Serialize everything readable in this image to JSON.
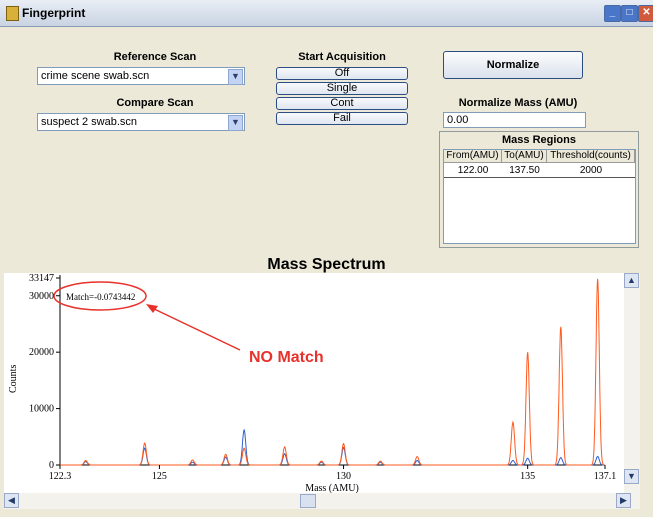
{
  "window": {
    "title": "Fingerprint"
  },
  "reference_scan": {
    "label": "Reference Scan",
    "value": "crime scene swab.scn"
  },
  "compare_scan": {
    "label": "Compare Scan",
    "value": "suspect 2 swab.scn"
  },
  "acquisition": {
    "label": "Start Acquisition",
    "buttons": [
      "Off",
      "Single",
      "Cont",
      "Fail"
    ]
  },
  "normalize": {
    "button_label": "Normalize",
    "mass_label": "Normalize Mass (AMU)",
    "mass_value": "0.00"
  },
  "mass_regions": {
    "title": "Mass Regions",
    "columns": [
      "From(AMU)",
      "To(AMU)",
      "Threshold(counts)"
    ],
    "rows": [
      [
        "122.00",
        "137.50",
        "2000"
      ]
    ]
  },
  "annotation": {
    "match_text": "Match=-0.0743442",
    "verdict": "NO Match",
    "color": "#e8312a"
  },
  "chart_data": {
    "type": "line",
    "title": "Mass Spectrum",
    "xlabel": "Mass (AMU)",
    "ylabel": "Counts",
    "xlim": [
      122.3,
      137.1
    ],
    "ylim": [
      0,
      33147
    ],
    "x_ticks": [
      "122.3",
      "125",
      "130",
      "135",
      "137.1"
    ],
    "y_ticks": [
      "0",
      "10000",
      "20000",
      "30000",
      "33147"
    ],
    "series": [
      {
        "color": "#ff5a1f",
        "peaks": [
          [
            123.0,
            800
          ],
          [
            124.6,
            3900
          ],
          [
            125.9,
            900
          ],
          [
            126.8,
            1900
          ],
          [
            127.3,
            3000
          ],
          [
            128.4,
            3200
          ],
          [
            129.4,
            700
          ],
          [
            130.0,
            3800
          ],
          [
            131.0,
            700
          ],
          [
            132.0,
            1500
          ],
          [
            134.6,
            7600
          ],
          [
            135.0,
            20000
          ],
          [
            135.9,
            24500
          ],
          [
            136.9,
            33000
          ]
        ]
      },
      {
        "color": "#2e5fd0",
        "peaks": [
          [
            123.0,
            600
          ],
          [
            124.6,
            3000
          ],
          [
            125.9,
            500
          ],
          [
            126.8,
            1400
          ],
          [
            127.3,
            6200
          ],
          [
            128.4,
            2000
          ],
          [
            129.4,
            500
          ],
          [
            130.0,
            3100
          ],
          [
            131.0,
            500
          ],
          [
            132.0,
            800
          ],
          [
            134.6,
            800
          ],
          [
            135.0,
            1200
          ],
          [
            135.9,
            1300
          ],
          [
            136.9,
            1500
          ]
        ]
      }
    ]
  }
}
